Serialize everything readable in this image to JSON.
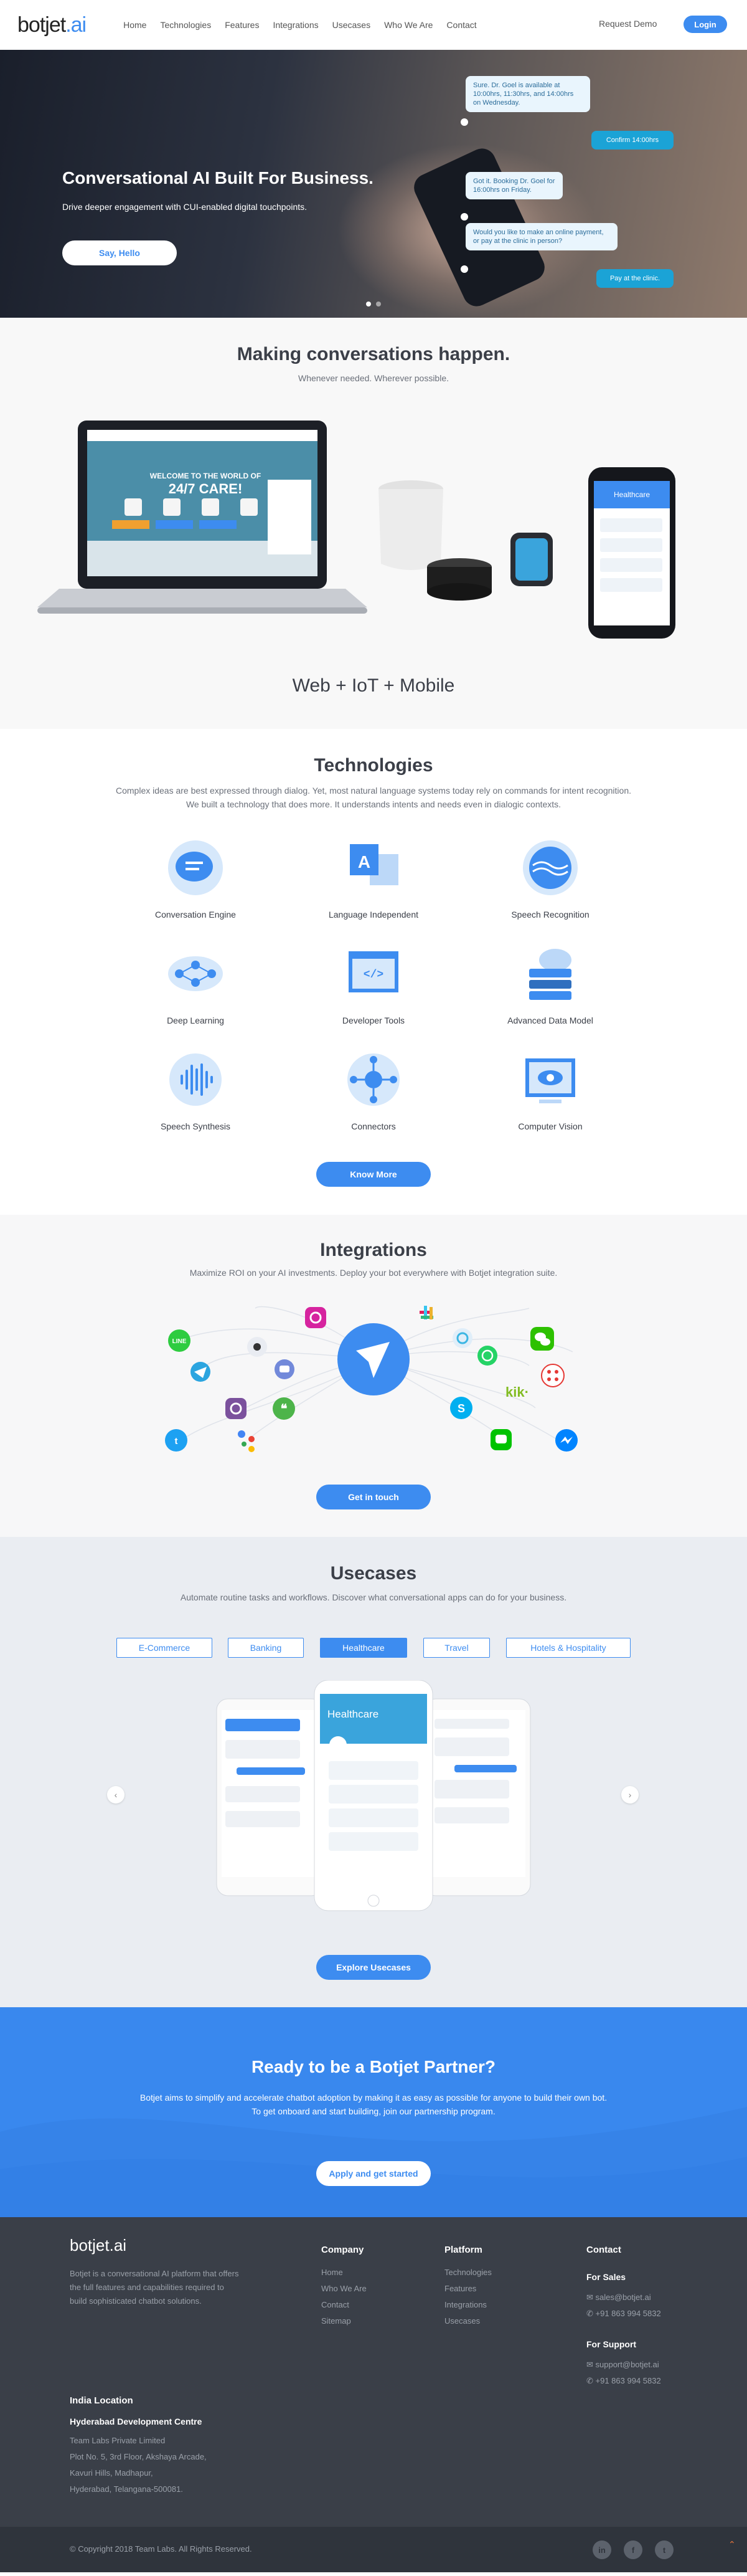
{
  "nav": {
    "logo_main": "botjet",
    "logo_ai": ".ai",
    "items": [
      "Home",
      "Technologies",
      "Features",
      "Integrations",
      "Usecases",
      "Who We Are",
      "Contact"
    ],
    "request_demo": "Request Demo",
    "login": "Login"
  },
  "hero": {
    "title": "Conversational AI Built For Business.",
    "subtitle": "Drive deeper engagement with CUI-enabled digital touchpoints.",
    "cta": "Say, Hello",
    "bubbles": [
      "Sure. Dr. Goel is available at 10:00hrs, 11:30hrs, and 14:00hrs on Wednesday.",
      "Confirm 14:00hrs",
      "Got it. Booking Dr. Goel for 16:00hrs on Friday.",
      "Would you like to make an online payment, or pay at the clinic in person?",
      "Pay at the clinic."
    ]
  },
  "making": {
    "title": "Making conversations happen.",
    "subtitle": "Whenever needed. Wherever possible.",
    "screen_text1": "WELCOME TO THE WORLD OF",
    "screen_text2": "24/7 CARE!",
    "phone_header": "Healthcare",
    "footer": "Web + IoT + Mobile"
  },
  "technologies": {
    "title": "Technologies",
    "subtitle1": "Complex ideas are best expressed through dialog. Yet, most natural language systems today rely on commands for intent recognition.",
    "subtitle2": "We built a technology that does more. It understands intents and needs even in dialogic contexts.",
    "items": [
      "Conversation Engine",
      "Language Independent",
      "Speech Recognition",
      "Deep Learning",
      "Developer Tools",
      "Advanced Data Model",
      "Speech Synthesis",
      "Connectors",
      "Computer Vision"
    ],
    "button": "Know More"
  },
  "integrations": {
    "title": "Integrations",
    "subtitle": "Maximize ROI on your AI investments. Deploy your bot everywhere with Botjet integration suite.",
    "button": "Get in touch",
    "kik": "kik·"
  },
  "usecases": {
    "title": "Usecases",
    "subtitle": "Automate routine tasks and workflows. Discover what conversational apps can do for your business.",
    "tabs": [
      "E-Commerce",
      "Banking",
      "Healthcare",
      "Travel",
      "Hotels & Hospitality"
    ],
    "active_tab": "Healthcare",
    "phone_header": "Healthcare",
    "button": "Explore Usecases"
  },
  "partner": {
    "title": "Ready to be a Botjet Partner?",
    "line1": "Botjet aims to simplify and accelerate chatbot adoption by making it as easy as possible for anyone to build their own bot.",
    "line2": "To get onboard and start building, join our partnership program.",
    "button": "Apply and get started"
  },
  "footer": {
    "logo": "botjet.ai",
    "about": [
      "Botjet is a conversational AI platform that offers",
      "the full features and capabilities required to",
      "build sophisticated chatbot solutions."
    ],
    "company": {
      "heading": "Company",
      "links": [
        "Home",
        "Who We Are",
        "Contact",
        "Sitemap"
      ]
    },
    "platform": {
      "heading": "Platform",
      "links": [
        "Technologies",
        "Features",
        "Integrations",
        "Usecases"
      ]
    },
    "contact": {
      "heading": "Contact",
      "sales": "For Sales",
      "sales_email": "sales@botjet.ai",
      "sales_phone": "+91 863 994 5832",
      "support": "For Support",
      "support_email": "support@botjet.ai",
      "support_phone": "+91 863 994 5832"
    },
    "location": {
      "heading": "India Location",
      "center": "Hyderabad Development Centre",
      "lines": [
        "Team Labs Private Limited",
        "Plot No. 5, 3rd Floor, Akshaya Arcade,",
        "Kavuri Hills, Madhapur,",
        "Hyderabad, Telangana-500081."
      ]
    },
    "copyright": "© Copyright 2018 Team Labs. All Rights Reserved.",
    "social": [
      "in",
      "f",
      "t"
    ]
  },
  "colors": {
    "accent": "#3d8cf0",
    "teal": "#1ba3d6",
    "footer_bg": "#3a3f48",
    "partner_bg": "#3988ee"
  }
}
